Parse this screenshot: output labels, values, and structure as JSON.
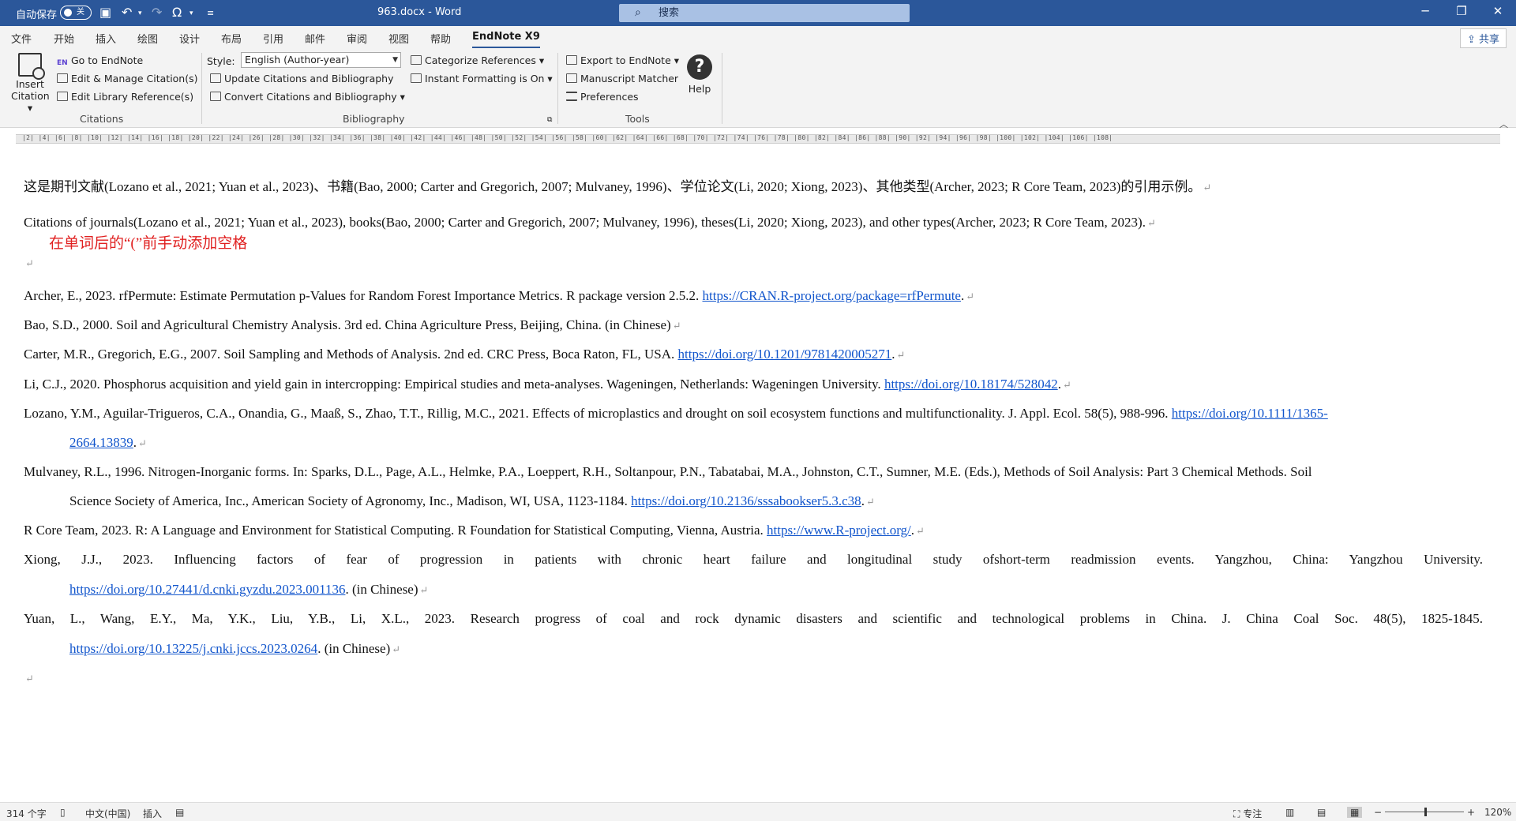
{
  "titlebar": {
    "autosave_label": "自动保存",
    "autosave_state": "关",
    "document_title": "963.docx  -  Word",
    "search_placeholder": "搜索"
  },
  "menu_tabs": [
    "文件",
    "开始",
    "插入",
    "绘图",
    "设计",
    "布局",
    "引用",
    "邮件",
    "审阅",
    "视图",
    "帮助",
    "EndNote X9"
  ],
  "share_label": "共享",
  "ribbon": {
    "insert_citation": "Insert Citation",
    "go_to_endnote": "Go to EndNote",
    "edit_manage_citations": "Edit & Manage Citation(s)",
    "edit_library_references": "Edit Library Reference(s)",
    "citations_group": "Citations",
    "style_label": "Style:",
    "style_value": "English (Author-year)",
    "update_citations": "Update Citations and Bibliography",
    "convert_citations": "Convert Citations and Bibliography",
    "categorize_references": "Categorize References",
    "instant_formatting": "Instant Formatting is On",
    "bibliography_group": "Bibliography",
    "export_to_endnote": "Export to EndNote",
    "manuscript_matcher": "Manuscript Matcher",
    "preferences": "Preferences",
    "tools_group": "Tools",
    "help": "Help"
  },
  "ruler_numbers": "|2| |4| |6| |8| |10| |12| |14| |16| |18| |20| |22| |24| |26| |28| |30| |32| |34| |36| |38| |40| |42| |44| |46| |48| |50| |52| |54| |56| |58| |60| |62| |64| |66| |68| |70| |72| |74| |76| |78| |80| |82| |84| |86| |88| |90| |92| |94| |96| |98| |100| |102| |104| |106| |108|",
  "document": {
    "para_cn": "这是期刊文献(Lozano et al., 2021; Yuan et al., 2023)、书籍(Bao, 2000; Carter and Gregorich, 2007; Mulvaney, 1996)、学位论文(Li, 2020; Xiong, 2023)、其他类型(Archer, 2023; R Core Team, 2023)的引用示例。",
    "para_en": "Citations of journals(Lozano et al., 2021; Yuan et al., 2023), books(Bao, 2000; Carter and Gregorich, 2007; Mulvaney, 1996), theses(Li, 2020; Xiong, 2023), and other types(Archer, 2023; R Core Team, 2023).",
    "annotation": "在单词后的“(”前手动添加空格",
    "references": [
      {
        "text": "Archer, E., 2023. rfPermute: Estimate Permutation p-Values for Random Forest Importance Metrics. R package version 2.5.2. ",
        "link": "https://CRAN.R-project.org/package=rfPermute",
        "tail": "."
      },
      {
        "text": "Bao, S.D., 2000. Soil and Agricultural Chemistry Analysis. 3rd ed. China Agriculture Press, Beijing, China. (in Chinese)",
        "link": "",
        "tail": ""
      },
      {
        "text": "Carter, M.R., Gregorich, E.G., 2007. Soil Sampling and Methods of Analysis. 2nd ed. CRC Press, Boca Raton, FL, USA. ",
        "link": "https://doi.org/10.1201/9781420005271",
        "tail": "."
      },
      {
        "text": "Li, C.J., 2020. Phosphorus acquisition and yield gain in intercropping: Empirical studies and meta-analyses. Wageningen, Netherlands: Wageningen University. ",
        "link": "https://doi.org/10.18174/528042",
        "tail": "."
      },
      {
        "text": "Lozano, Y.M., Aguilar-Trigueros, C.A., Onandia, G., Maaß, S., Zhao, T.T., Rillig, M.C., 2021. Effects of microplastics and drought on soil ecosystem functions and multifunctionality. J. Appl. Ecol. 58(5), 988-996. ",
        "link1": "https://doi.org/10.1111/1365-",
        "link2": "2664.13839",
        "tail": "."
      },
      {
        "text": "Mulvaney, R.L., 1996. Nitrogen-Inorganic forms. In: Sparks, D.L., Page, A.L., Helmke, P.A., Loeppert, R.H., Soltanpour, P.N., Tabatabai, M.A., Johnston, C.T., Sumner, M.E. (Eds.), Methods of Soil Analysis: Part 3 Chemical Methods. Soil",
        "cont": "Science Society of America, Inc., American Society of Agronomy, Inc., Madison, WI, USA, 1123-1184. ",
        "link": "https://doi.org/10.2136/sssabookser5.3.c38",
        "tail": "."
      },
      {
        "text": "R Core Team, 2023. R: A Language and Environment for Statistical Computing. R Foundation for Statistical Computing, Vienna, Austria. ",
        "link": "https://www.R-project.org/",
        "tail": "."
      },
      {
        "text": "Xiong, J.J., 2023. Influencing factors of fear of progression in patients with chronic heart failure and longitudinal study ofshort-term readmission events. Yangzhou, China: Yangzhou University.",
        "link": "https://doi.org/10.27441/d.cnki.gyzdu.2023.001136",
        "tail": ". (in Chinese)"
      },
      {
        "text": "Yuan, L., Wang, E.Y., Ma, Y.K., Liu, Y.B., Li, X.L., 2023. Research progress of coal and rock dynamic disasters and scientific and technological problems in China. J. China Coal Soc. 48(5), 1825-1845.",
        "link": "https://doi.org/10.13225/j.cnki.jccs.2023.0264",
        "tail": ". (in Chinese)"
      }
    ]
  },
  "statusbar": {
    "word_count": "314 个字",
    "language": "中文(中国)",
    "mode": "插入",
    "focus": "专注",
    "zoom_minus": "−",
    "zoom_plus": "+",
    "zoom": "120%"
  }
}
